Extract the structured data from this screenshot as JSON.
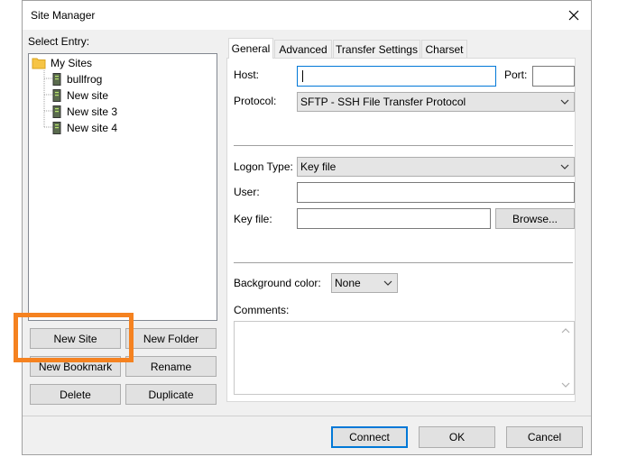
{
  "window": {
    "title": "Site Manager"
  },
  "left": {
    "select_entry_label": "Select Entry:",
    "tree": {
      "root": "My Sites",
      "sites": [
        "bullfrog",
        "New site",
        "New site 3",
        "New site 4"
      ]
    },
    "buttons": {
      "new_site": "New Site",
      "new_folder": "New Folder",
      "new_bookmark": "New Bookmark",
      "rename": "Rename",
      "delete": "Delete",
      "duplicate": "Duplicate"
    }
  },
  "tabs": [
    "General",
    "Advanced",
    "Transfer Settings",
    "Charset"
  ],
  "general": {
    "host_label": "Host:",
    "host_value": "",
    "port_label": "Port:",
    "port_value": "",
    "protocol_label": "Protocol:",
    "protocol_value": "SFTP - SSH File Transfer Protocol",
    "logon_type_label": "Logon Type:",
    "logon_type_value": "Key file",
    "user_label": "User:",
    "user_value": "",
    "key_file_label": "Key file:",
    "key_file_value": "",
    "browse_label": "Browse...",
    "background_color_label": "Background color:",
    "background_color_value": "None",
    "comments_label": "Comments:",
    "comments_value": ""
  },
  "footer": {
    "connect": "Connect",
    "ok": "OK",
    "cancel": "Cancel"
  },
  "colors": {
    "highlight": "#f58220",
    "accent": "#0078d7",
    "folder": "#f6c444"
  }
}
